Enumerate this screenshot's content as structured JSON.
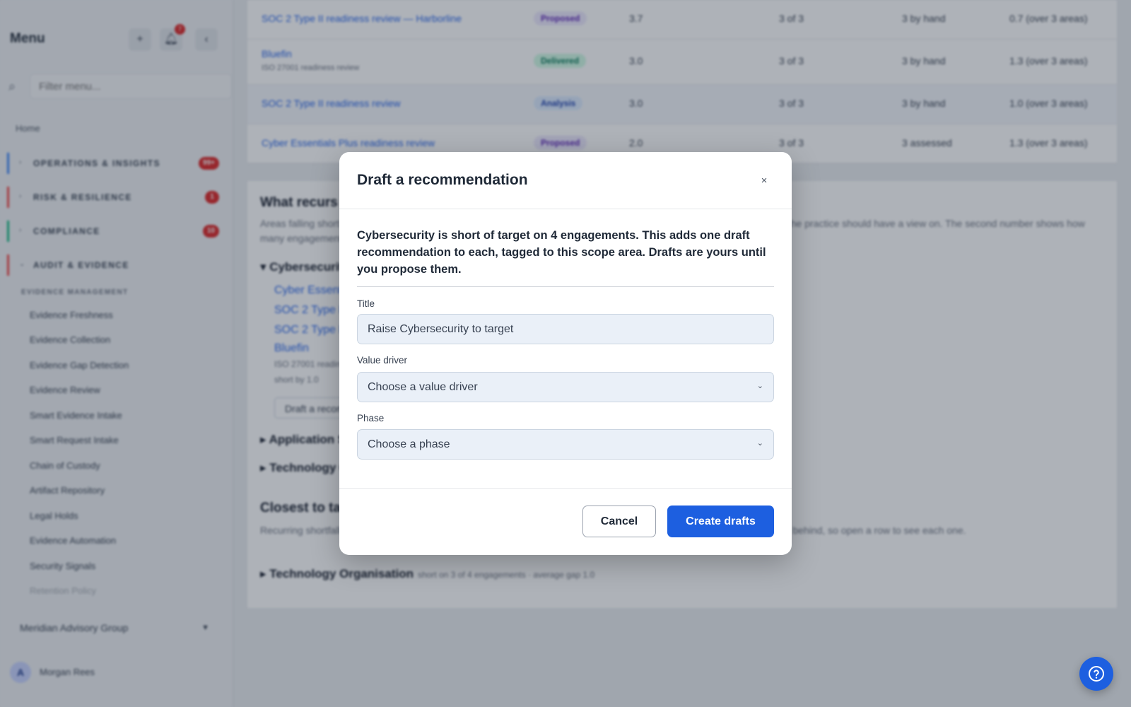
{
  "sidebar": {
    "title": "Menu",
    "notification_count": "7",
    "filter_placeholder": "Filter menu...",
    "home_label": "Home",
    "groups": [
      {
        "label": "OPERATIONS & INSIGHTS",
        "badge": "99+",
        "color": "#3b82f6"
      },
      {
        "label": "RISK & RESILIENCE",
        "badge": "1",
        "color": "#ef4444"
      },
      {
        "label": "COMPLIANCE",
        "badge": "10",
        "color": "#10b981"
      },
      {
        "label": "AUDIT & EVIDENCE",
        "badge": "",
        "color": "#ef4444"
      }
    ],
    "subhead": "EVIDENCE MANAGEMENT",
    "items": [
      "Evidence Freshness",
      "Evidence Collection",
      "Evidence Gap Detection",
      "Evidence Review",
      "Smart Evidence Intake",
      "Smart Request Intake",
      "Chain of Custody",
      "Artifact Repository",
      "Legal Holds",
      "Evidence Automation",
      "Security Signals",
      "Retention Policy"
    ],
    "org": "Meridian Advisory Group",
    "user_initial": "A",
    "user_name": "Morgan Rees"
  },
  "table": {
    "rows": [
      {
        "name": "SOC 2 Type II readiness review — Harborline",
        "sub": "",
        "status": "Proposed",
        "score": "3.7",
        "coverage": "3 of 3",
        "method": "3 by hand",
        "gap": "0.7 (over 3 areas)"
      },
      {
        "name": "Bluefin",
        "sub": "ISO 27001 readiness review",
        "status": "Delivered",
        "score": "3.0",
        "coverage": "3 of 3",
        "method": "3 by hand",
        "gap": "1.3 (over 3 areas)"
      },
      {
        "name": "SOC 2 Type II readiness review",
        "sub": "",
        "status": "Analysis",
        "score": "3.0",
        "coverage": "3 of 3",
        "method": "3 by hand",
        "gap": "1.0 (over 3 areas)"
      },
      {
        "name": "Cyber Essentials Plus readiness review",
        "sub": "",
        "status": "Proposed",
        "score": "2.0",
        "coverage": "3 of 3",
        "method": "3 assessed",
        "gap": "1.3 (over 3 areas)"
      }
    ]
  },
  "section": {
    "title": "What recurs",
    "para": "Areas falling short on many engagements. A shortfall on one engagement may be a one-off; short on many is something the practice should have a view on. The second number shows how many engagements were scored, so you can tell whether a shortfall could be measured at all.",
    "acc1": "Cybersecurity",
    "acc1_links": [
      "Cyber Essentials Plus readiness review",
      "SOC 2 Type II readiness review",
      "SOC 2 Type II readiness review — Harborline",
      "Bluefin"
    ],
    "acc1_note1": "ISO 27001 readiness review",
    "acc1_note2": "short by 1.0",
    "acc1_button": "Draft a recommendation",
    "acc2": "Application Security",
    "acc3": "Technology Organisation",
    "closest_title": "Closest to target",
    "closest_para": "Recurring shortfalls sorted by how small the average gap is. An average gap can hide a single engagement that is further behind, so open a row to see each one.",
    "closest_row": "Technology Organisation",
    "closest_row_note": "short on 3 of 4 engagements · average gap 1.0"
  },
  "modal": {
    "title": "Draft a recommendation",
    "close": "×",
    "lead_text": "Cybersecurity is short of target on 4 engagements. This adds one draft recommendation to each, tagged to this scope area. Drafts are yours until you propose them.",
    "title_label": "Title",
    "title_value": "Raise Cybersecurity to target",
    "driver_label": "Value driver",
    "driver_value": "Choose a value driver",
    "phase_label": "Phase",
    "phase_value": "Choose a phase",
    "cancel_label": "Cancel",
    "create_label": "Create drafts"
  },
  "colors": {
    "primary": "#1d5fe0",
    "proposed": "#ede9fe",
    "delivered": "#d1fae5",
    "analysis": "#dbeafe"
  }
}
